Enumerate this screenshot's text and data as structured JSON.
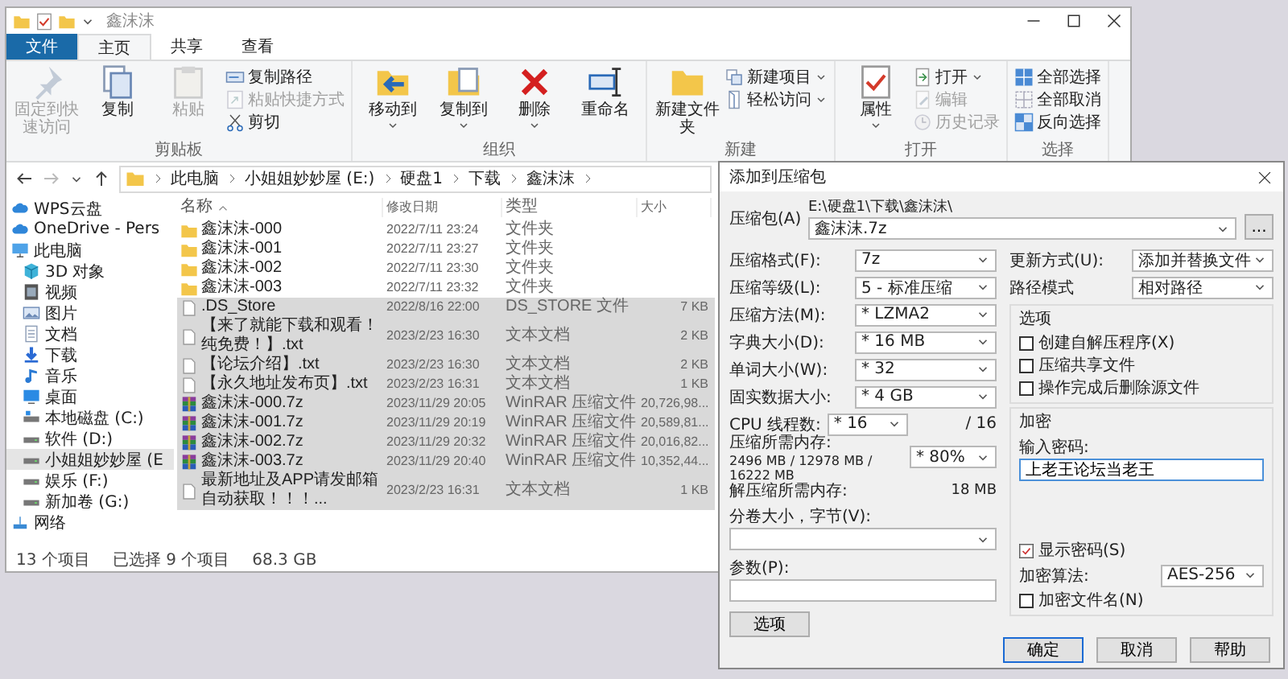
{
  "explorer": {
    "title": "鑫沫沫",
    "ribbon_tabs": [
      {
        "label": "文件",
        "kind": "menu",
        "selected": false
      },
      {
        "label": "主页",
        "kind": "tab",
        "selected": true
      },
      {
        "label": "共享",
        "kind": "tab",
        "selected": false
      },
      {
        "label": "查看",
        "kind": "tab",
        "selected": false
      }
    ],
    "ribbon_groups": [
      {
        "label": "剪贴板",
        "large": [
          {
            "label": "固定到快速访问",
            "disabled": true,
            "menu": false
          },
          {
            "label": "复制",
            "disabled": false,
            "menu": false
          },
          {
            "label": "粘贴",
            "disabled": true,
            "menu": false
          }
        ],
        "small": [
          {
            "label": "复制路径",
            "disabled": false,
            "menu": false
          },
          {
            "label": "粘贴快捷方式",
            "disabled": true,
            "menu": false
          },
          {
            "label": "剪切",
            "disabled": false,
            "menu": false
          }
        ]
      },
      {
        "label": "组织",
        "large": [
          {
            "label": "移动到",
            "disabled": false,
            "menu": true
          },
          {
            "label": "复制到",
            "disabled": false,
            "menu": true
          },
          {
            "label": "删除",
            "disabled": false,
            "menu": true
          },
          {
            "label": "重命名",
            "disabled": false,
            "menu": false
          }
        ]
      },
      {
        "label": "新建",
        "large": [
          {
            "label": "新建文件夹",
            "disabled": false,
            "menu": false
          }
        ],
        "small": [
          {
            "label": "新建项目",
            "disabled": false,
            "menu": true
          },
          {
            "label": "轻松访问",
            "disabled": false,
            "menu": true
          }
        ]
      },
      {
        "label": "打开",
        "large": [
          {
            "label": "属性",
            "disabled": false,
            "menu": true
          }
        ],
        "small": [
          {
            "label": "打开",
            "disabled": false,
            "menu": true
          },
          {
            "label": "编辑",
            "disabled": true,
            "menu": false
          },
          {
            "label": "历史记录",
            "disabled": true,
            "menu": false
          }
        ]
      },
      {
        "label": "选择",
        "small": [
          {
            "label": "全部选择",
            "disabled": false,
            "menu": false
          },
          {
            "label": "全部取消",
            "disabled": false,
            "menu": false
          },
          {
            "label": "反向选择",
            "disabled": false,
            "menu": false
          }
        ]
      }
    ],
    "breadcrumb": [
      "此电脑",
      "小姐姐妙妙屋 (E:)",
      "硬盘1",
      "下载",
      "鑫沫沫"
    ],
    "sidebar": {
      "items": [
        {
          "label": "WPS云盘",
          "selected": false
        },
        {
          "label": "OneDrive - Pers",
          "selected": false
        },
        {
          "label": "此电脑",
          "selected": false,
          "children": [
            {
              "label": "3D 对象",
              "selected": false
            },
            {
              "label": "视频",
              "selected": false
            },
            {
              "label": "图片",
              "selected": false
            },
            {
              "label": "文档",
              "selected": false
            },
            {
              "label": "下载",
              "selected": false
            },
            {
              "label": "音乐",
              "selected": false
            },
            {
              "label": "桌面",
              "selected": false
            },
            {
              "label": "本地磁盘 (C:)",
              "selected": false
            },
            {
              "label": "软件 (D:)",
              "selected": false
            },
            {
              "label": "小姐姐妙妙屋 (E",
              "selected": true
            },
            {
              "label": "娱乐 (F:)",
              "selected": false
            },
            {
              "label": "新加卷 (G:)",
              "selected": false
            }
          ]
        },
        {
          "label": "网络",
          "selected": false
        }
      ]
    },
    "table": {
      "columns": [
        "名称",
        "修改日期",
        "类型",
        "大小"
      ],
      "rows": [
        {
          "kind": "folder",
          "name": "鑫沫沫-000",
          "date": "2022/7/11 23:24",
          "type": "文件夹",
          "selected": false
        },
        {
          "kind": "folder",
          "name": "鑫沫沫-001",
          "date": "2022/7/11 23:27",
          "type": "文件夹",
          "selected": false
        },
        {
          "kind": "folder",
          "name": "鑫沫沫-002",
          "date": "2022/7/11 23:30",
          "type": "文件夹",
          "selected": false
        },
        {
          "kind": "folder",
          "name": "鑫沫沫-003",
          "date": "2022/7/11 23:32",
          "type": "文件夹",
          "selected": false
        },
        {
          "kind": "file",
          "name": ".DS_Store",
          "date": "2022/8/16 22:00",
          "type": "DS_STORE 文件",
          "size": "7 KB",
          "selected": true
        },
        {
          "kind": "file",
          "name": "【来了就能下载和观看！纯免费！】.txt",
          "date": "2023/2/23 16:30",
          "type": "文本文档",
          "size": "2 KB",
          "selected": true
        },
        {
          "kind": "file",
          "name": "【论坛介绍】.txt",
          "date": "2023/2/23 16:30",
          "type": "文本文档",
          "size": "2 KB",
          "selected": true
        },
        {
          "kind": "file",
          "name": "【永久地址发布页】.txt",
          "date": "2023/2/23 16:31",
          "type": "文本文档",
          "size": "1 KB",
          "selected": true
        },
        {
          "kind": "archive",
          "name": "鑫沫沫-000.7z",
          "date": "2023/11/29 20:05",
          "type": "WinRAR 压缩文件",
          "size": "20,726,98...",
          "selected": true
        },
        {
          "kind": "archive",
          "name": "鑫沫沫-001.7z",
          "date": "2023/11/29 20:19",
          "type": "WinRAR 压缩文件",
          "size": "20,589,81...",
          "selected": true
        },
        {
          "kind": "archive",
          "name": "鑫沫沫-002.7z",
          "date": "2023/11/29 20:32",
          "type": "WinRAR 压缩文件",
          "size": "20,016,82...",
          "selected": true
        },
        {
          "kind": "archive",
          "name": "鑫沫沫-003.7z",
          "date": "2023/11/29 20:40",
          "type": "WinRAR 压缩文件",
          "size": "10,352,44...",
          "selected": true
        },
        {
          "kind": "file",
          "name": "最新地址及APP请发邮箱自动获取！！！...",
          "date": "2023/2/23 16:31",
          "type": "文本文档",
          "size": "1 KB",
          "selected": true
        }
      ]
    },
    "status_bar": [
      "13 个项目",
      "已选择 9 个项目",
      "68.3 GB"
    ]
  },
  "dialog": {
    "title": "添加到压缩包",
    "archive": {
      "label": "压缩包(A)",
      "path": "E:\\硬盘1\\下载\\鑫沫沫\\",
      "value": "鑫沫沫.7z",
      "browse": "..."
    },
    "left_fields": [
      {
        "label": "压缩格式(F):",
        "value": "7z"
      },
      {
        "label": "压缩等级(L):",
        "value": "5 - 标准压缩"
      },
      {
        "label": "压缩方法(M):",
        "value": "* LZMA2"
      },
      {
        "label": "字典大小(D):",
        "value": "* 16 MB"
      },
      {
        "label": "单词大小(W):",
        "value": "* 32"
      },
      {
        "label": "固实数据大小:",
        "value": "* 4 GB"
      },
      {
        "label": "CPU 线程数:",
        "value": "* 16",
        "suffix": "/ 16"
      }
    ],
    "memory": {
      "label": "压缩所需内存:",
      "detail": "2496 MB / 12978 MB / 16222 MB",
      "value": "* 80%"
    },
    "decompress": {
      "label": "解压缩所需内存:",
      "value": "18 MB"
    },
    "volume": {
      "label": "分卷大小，字节(V):"
    },
    "params": {
      "label": "参数(P):"
    },
    "options_button": "选项",
    "right_fields": [
      {
        "label": "更新方式(U):",
        "value": "添加并替换文件"
      },
      {
        "label": "路径模式",
        "value": "相对路径"
      }
    ],
    "options_group": {
      "title": "选项",
      "checkboxes": [
        {
          "label": "创建自解压程序(X)",
          "checked": false
        },
        {
          "label": "压缩共享文件",
          "checked": false
        },
        {
          "label": "操作完成后删除源文件",
          "checked": false
        }
      ]
    },
    "encryption": {
      "title": "加密",
      "password_label": "输入密码:",
      "password": "上老王论坛当老王",
      "show_password": {
        "label": "显示密码(S)",
        "checked": true
      },
      "method_label": "加密算法:",
      "method": "AES-256",
      "encrypt_names": {
        "label": "加密文件名(N)",
        "checked": false
      }
    },
    "buttons": [
      {
        "label": "确定",
        "default": true
      },
      {
        "label": "取消",
        "default": false
      },
      {
        "label": "帮助",
        "default": false
      }
    ]
  }
}
